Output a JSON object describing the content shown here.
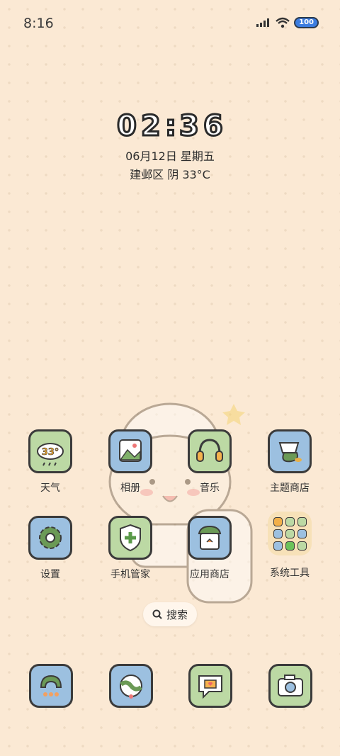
{
  "status_bar": {
    "time": "8:16",
    "battery": "100"
  },
  "clock": {
    "digits": [
      "0",
      "2",
      ":",
      "3",
      "6"
    ]
  },
  "date": {
    "line1": "06月12日 星期五",
    "line2": "建邺区 阴 33°C"
  },
  "apps": {
    "weather": {
      "label": "天气",
      "icon_text": "33°"
    },
    "gallery": {
      "label": "相册"
    },
    "music": {
      "label": "音乐"
    },
    "themes": {
      "label": "主题商店"
    },
    "settings": {
      "label": "设置"
    },
    "security": {
      "label": "手机管家"
    },
    "appstore": {
      "label": "应用商店"
    },
    "systools": {
      "label": "系统工具"
    }
  },
  "search": {
    "label": "搜索"
  },
  "dock": [
    "phone",
    "browser",
    "messages",
    "camera"
  ],
  "colors": {
    "background": "#fbe9d4",
    "icon_green": "#bcd9a4",
    "icon_blue": "#9cc0e0",
    "outline": "#3b3b3b"
  }
}
